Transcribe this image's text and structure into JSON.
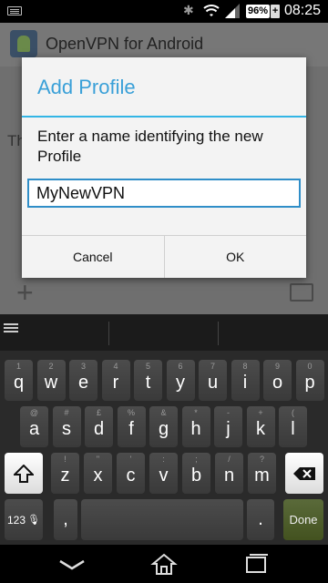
{
  "status_bar": {
    "battery_percent": "96%",
    "battery_plus": "+",
    "time": "08:25",
    "icons": [
      "keyboard-icon",
      "bluetooth-icon",
      "wifi-icon",
      "signal-icon",
      "battery-icon"
    ]
  },
  "app": {
    "title": "OpenVPN for Android",
    "behind_text": "Th"
  },
  "dialog": {
    "title": "Add Profile",
    "message": "Enter a name identifying the new Profile",
    "input_value": "MyNewVPN",
    "cancel_label": "Cancel",
    "ok_label": "OK"
  },
  "keyboard": {
    "row1": [
      {
        "main": "q",
        "alt": "1"
      },
      {
        "main": "w",
        "alt": "2"
      },
      {
        "main": "e",
        "alt": "3"
      },
      {
        "main": "r",
        "alt": "4"
      },
      {
        "main": "t",
        "alt": "5"
      },
      {
        "main": "y",
        "alt": "6"
      },
      {
        "main": "u",
        "alt": "7"
      },
      {
        "main": "i",
        "alt": "8"
      },
      {
        "main": "o",
        "alt": "9"
      },
      {
        "main": "p",
        "alt": "0"
      }
    ],
    "row2": [
      {
        "main": "a",
        "alt": "@"
      },
      {
        "main": "s",
        "alt": "#"
      },
      {
        "main": "d",
        "alt": "£"
      },
      {
        "main": "f",
        "alt": "%"
      },
      {
        "main": "g",
        "alt": "&"
      },
      {
        "main": "h",
        "alt": "*"
      },
      {
        "main": "j",
        "alt": "-"
      },
      {
        "main": "k",
        "alt": "+"
      },
      {
        "main": "l",
        "alt": "("
      }
    ],
    "row3": [
      {
        "main": "z",
        "alt": "!"
      },
      {
        "main": "x",
        "alt": "\""
      },
      {
        "main": "c",
        "alt": "'"
      },
      {
        "main": "v",
        "alt": ":"
      },
      {
        "main": "b",
        "alt": ";"
      },
      {
        "main": "n",
        "alt": "/"
      },
      {
        "main": "m",
        "alt": "?"
      }
    ],
    "num_key_label": "123",
    "comma_label": ",",
    "period_label": ".",
    "done_label": "Done"
  },
  "colors": {
    "accent": "#33b5e5",
    "title_blue": "#3aa0d8",
    "done_key": "#4b5a2a"
  }
}
